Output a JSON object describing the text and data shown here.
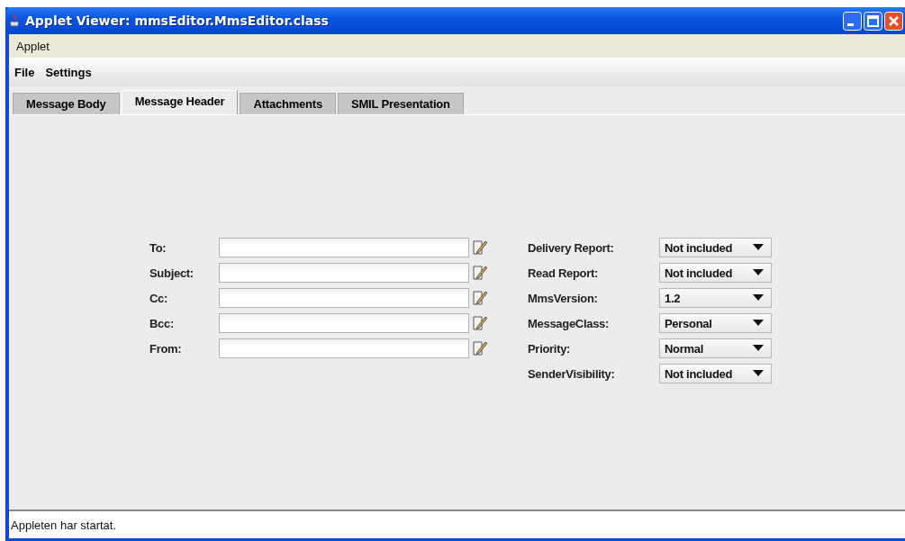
{
  "window": {
    "title": "Applet Viewer: mmsEditor.MmsEditor.class"
  },
  "applet_menu": [
    "Applet"
  ],
  "menu_bar": [
    "File",
    "Settings"
  ],
  "tabs": [
    {
      "label": "Message Body",
      "selected": false
    },
    {
      "label": "Message Header",
      "selected": true
    },
    {
      "label": "Attachments",
      "selected": false
    },
    {
      "label": "SMIL Presentation",
      "selected": false
    }
  ],
  "address_fields": [
    {
      "label": "To:"
    },
    {
      "label": "Subject:"
    },
    {
      "label": "Cc:"
    },
    {
      "label": "Bcc:"
    },
    {
      "label": "From:"
    }
  ],
  "options": [
    {
      "label": "Delivery Report:",
      "value": "Not included"
    },
    {
      "label": "Read Report:",
      "value": "Not included"
    },
    {
      "label": "MmsVersion:",
      "value": "1.2"
    },
    {
      "label": "MessageClass:",
      "value": "Personal"
    },
    {
      "label": "Priority:",
      "value": "Normal"
    },
    {
      "label": "SenderVisibility:",
      "value": "Not included"
    }
  ],
  "status_bar": "Appleten har startat."
}
